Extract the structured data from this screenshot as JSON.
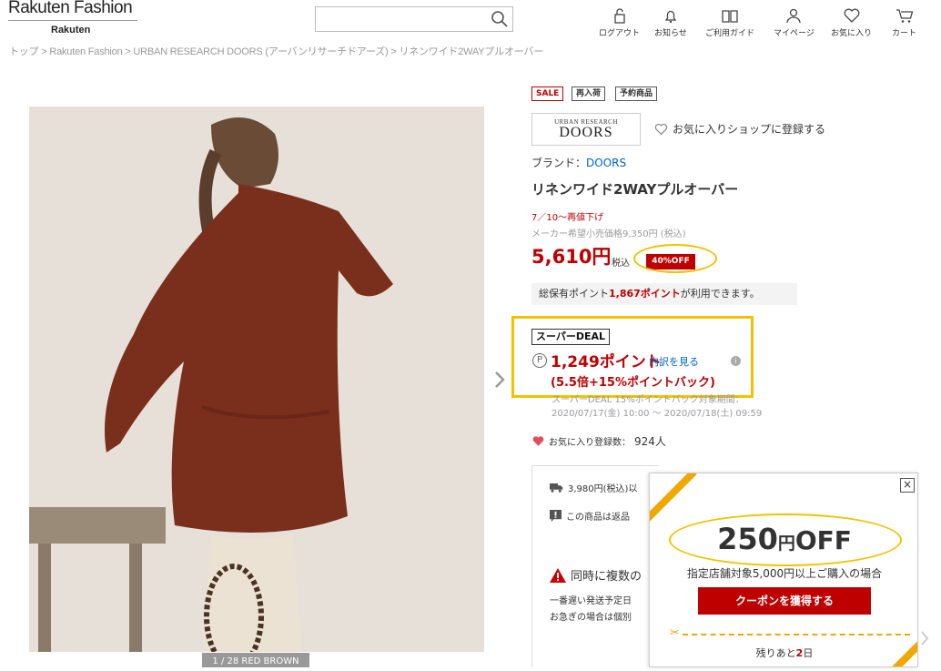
{
  "header": {
    "logo_main": "Rakuten Fashion",
    "logo_sub": "Rakuten",
    "search": {
      "value": "",
      "placeholder": ""
    },
    "nav": [
      {
        "label": "ログアウト",
        "icon": "lock-icon"
      },
      {
        "label": "お知らせ",
        "icon": "bell-icon"
      },
      {
        "label": "ご利用ガイド",
        "icon": "book-icon"
      },
      {
        "label": "マイページ",
        "icon": "person-icon"
      },
      {
        "label": "お気に入り",
        "icon": "heart-icon"
      },
      {
        "label": "カート",
        "icon": "cart-icon"
      }
    ]
  },
  "breadcrumb": "トップ > Rakuten Fashion > URBAN RESEARCH DOORS (アーバンリサーチドアーズ) > リネンワイド2WAYプルオーバー",
  "gallery": {
    "counter": "1 / 28   RED BROWN"
  },
  "product": {
    "tags": [
      "SALE",
      "再入荷",
      "予約商品"
    ],
    "shop_logo_top": "URBAN RESEARCH",
    "shop_logo_main": "DOORS",
    "fav_shop": "お気に入りショップに登録する",
    "brand_label": "ブランド：",
    "brand_name": "DOORS",
    "title": "リネンワイド2WAYプルオーバー",
    "repriced": "7／10～再値下げ",
    "msrp": "メーカー希望小売価格9,350円 (税込)",
    "price": "5,610円",
    "tax": "税込",
    "off": "40%OFF",
    "points_pre": "総保有ポイント",
    "points_val": "1,867ポイント",
    "points_post": "が利用できます。",
    "deal_label": "スーパーDEAL",
    "deal_points": "1,249ポイント",
    "deal_breakdown": "内訳を見る",
    "deal_bonus": "(5.5倍+15%ポイントバック)",
    "deal_period_1": "スーパーDEAL 15%ポイントバック対象期間：",
    "deal_period_2": "2020/07/17(金) 10:00 ～ 2020/07/18(土) 09:59",
    "fav_count_label": "お気に入り登録数：",
    "fav_count": "924人",
    "ship_1": "3,980円(税込)以",
    "ship_2": "この商品は返品",
    "warn": "同時に複数の",
    "note_1": "一番遅い発送予定日",
    "note_2": "お急ぎの場合は個別"
  },
  "coupon": {
    "close": "×",
    "amount": "250",
    "yen": "円",
    "off": "OFF",
    "condition": "指定店舗対象5,000円以上ご購入の場合",
    "button": "クーポンを獲得する",
    "remain_pre": "残りあと",
    "remain_days": "2",
    "remain_post": "日"
  },
  "colors": {
    "accent_red": "#bf0000",
    "highlight_yellow": "#f2c200",
    "stripe_orange": "#f0a800",
    "link_blue": "#0066c0"
  }
}
